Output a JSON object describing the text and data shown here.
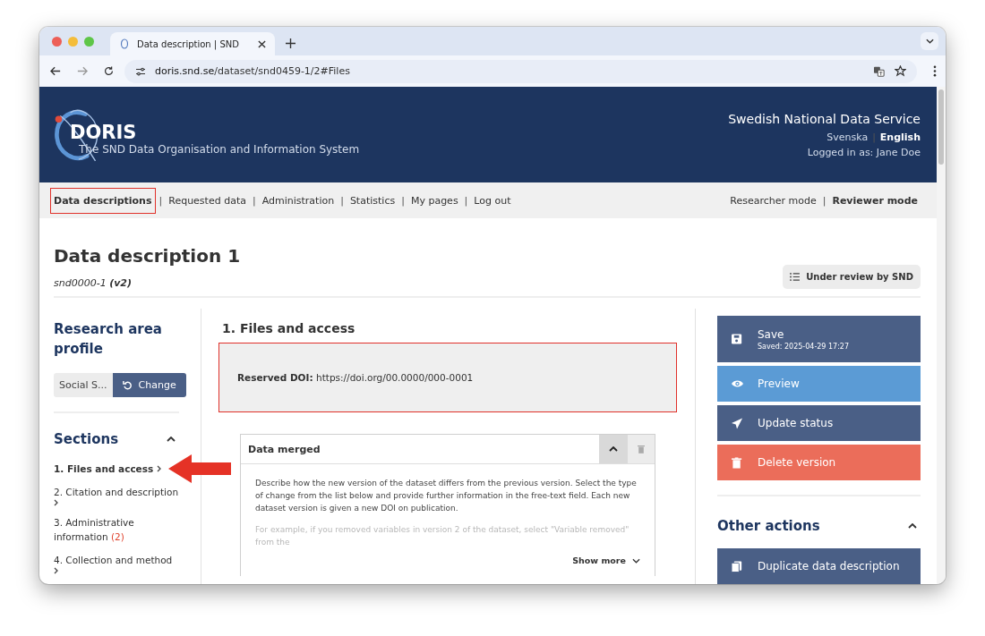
{
  "browser": {
    "tab": {
      "title": "Data description | SND",
      "selected": true
    },
    "url_host": "doris.snd.se",
    "url_path": "/dataset/snd0459-1/2#Files"
  },
  "header": {
    "logo_text": "DORIS",
    "subtitle": "The SND Data Organisation and Information System",
    "org": "Swedish National Data Service",
    "languages": [
      {
        "label": "Svenska",
        "selected": false
      },
      {
        "label": "English",
        "selected": true
      }
    ],
    "login": "Logged in as: Jane Doe",
    "separator": "|"
  },
  "nav": {
    "items": [
      {
        "label": "Data descriptions",
        "selected": true,
        "highlighted": true
      },
      {
        "label": "Requested data",
        "selected": false,
        "highlighted": false
      },
      {
        "label": "Administration",
        "selected": false,
        "highlighted": false
      },
      {
        "label": "Statistics",
        "selected": false,
        "highlighted": false
      },
      {
        "label": "My pages",
        "selected": false,
        "highlighted": false
      },
      {
        "label": "Log out",
        "selected": false,
        "highlighted": false
      }
    ],
    "modes": [
      {
        "label": "Researcher mode",
        "selected": false
      },
      {
        "label": "Reviewer mode",
        "selected": true
      }
    ],
    "separator": "|"
  },
  "page": {
    "title": "Data description 1",
    "subtitle": "snd0000-1 **(v2)**",
    "status": "Under review by SND"
  },
  "sidebar": {
    "profile_heading": "Research area profile",
    "profile_value": "Social S...",
    "change_button": "Change",
    "sections_heading": "Sections",
    "sections_expanded": true,
    "sections": [
      {
        "label": "1. Files and access",
        "selected": true,
        "arrow": true
      },
      {
        "label": "2. Citation and description",
        "selected": false,
        "arrow": false
      },
      {
        "label": "3. Administrative information",
        "count": "(2)",
        "selected": false,
        "arrow": false
      },
      {
        "label": "4. Collection and method",
        "selected": false,
        "arrow": false
      }
    ]
  },
  "main": {
    "heading": "1. Files and access",
    "doi": {
      "text": "**Reserved DOI:** https://doi.org/00.0000/000-0001",
      "highlighted": true
    },
    "panel": {
      "title": "Data merged",
      "expanded": true,
      "description": "Describe how the new version of the dataset differs from the previous version. Select the type of change from the list below and provide further information in the free-text field. Each new dataset version is given a new DOI on publication.",
      "faded_text": "For example, if you removed variables in version 2 of the dataset, select \"Variable removed\" from the",
      "show_more": "Show more"
    }
  },
  "actions": {
    "buttons": [
      {
        "label": "Save",
        "sublabel": "Saved: 2025-04-29 17:27",
        "kind": "dark"
      },
      {
        "label": "Preview",
        "kind": "info"
      },
      {
        "label": "Update status",
        "kind": "dark"
      },
      {
        "label": "Delete version",
        "kind": "danger"
      }
    ],
    "other_heading": "Other actions",
    "other_expanded": true,
    "other_buttons": [
      {
        "label": "Duplicate data description",
        "kind": "dark"
      }
    ]
  }
}
